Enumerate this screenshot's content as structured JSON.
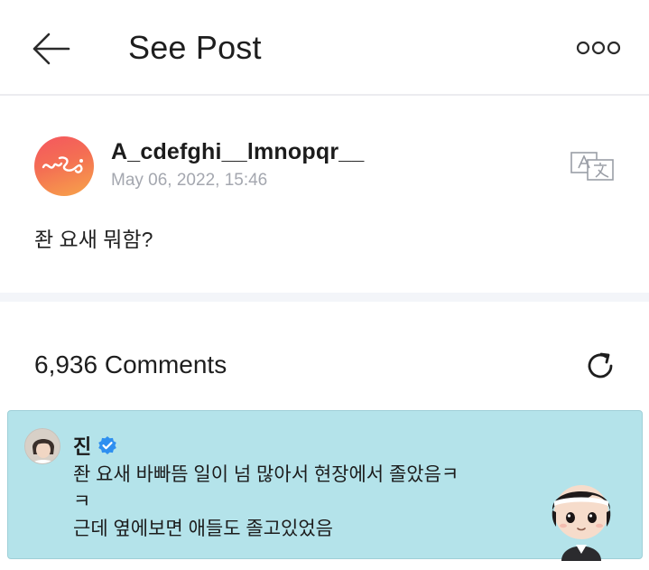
{
  "header": {
    "title": "See Post",
    "back_icon": "arrow-left-icon",
    "more_icon": "more-horizontal-icon"
  },
  "post": {
    "username": "A_cdefghi__lmnopqr__",
    "date": "May 06, 2022, 15:46",
    "text": "좐 요새 뭐함?",
    "translate_icon": "translate-icon",
    "avatar_colors": [
      "#f5565f",
      "#f7a54a"
    ]
  },
  "comments": {
    "count_label": "6,936 Comments",
    "refresh_icon": "refresh-icon"
  },
  "highlighted_comment": {
    "name": "진",
    "verified_icon": "verified-badge-icon",
    "lines": [
      "좐 요새 바빠뜸 일이 넘 많아서 현장에서 졸았음ㅋ",
      "ㅋ",
      "근데 옆에보면 애들도 졸고있었음"
    ],
    "background_color": "#b4e3ea",
    "sticker": "character-sticker"
  }
}
